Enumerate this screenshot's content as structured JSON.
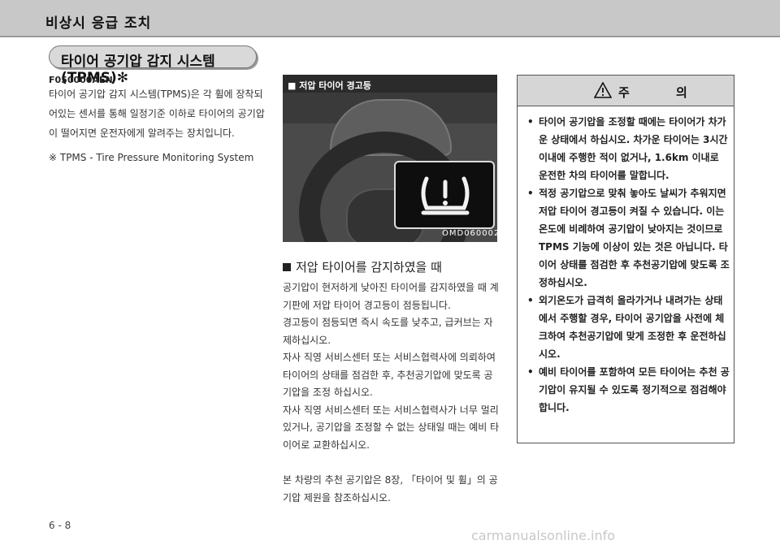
{
  "header": {
    "title": "비상시 응급 조치"
  },
  "section": {
    "title": "타이어 공기압 감지 시스템(TPMS)✻",
    "code": "F050000AEN",
    "intro": "타이어 공기압 감지 시스템(TPMS)은 각 휠에 장착되어있는 센서를 통해 일정기준 이하로 타이어의 공기압이 떨어지면 운전자에게 알려주는 장치입니다.",
    "note": "※ TPMS - Tire Pressure Monitoring System"
  },
  "photo": {
    "label": "■ 저압 타이어 경고등",
    "id": "OMD060002"
  },
  "low_pressure": {
    "heading": "저압 타이어를 감지하였을 때",
    "paragraphs": [
      "공기압이 현저하게 낮아진 타이어를 감지하였을 때 계기판에 저압 타이어 경고등이 점등됩니다.",
      "경고등이 점등되면 즉시 속도를 낮추고, 급커브는 자제하십시오.",
      "자사 직영 서비스센터 또는 서비스협력사에 의뢰하여 타이어의 상태를 점검한 후, 추천공기압에 맞도록 공기압을 조정 하십시오.",
      "자사 직영 서비스센터 또는 서비스협력사가 너무 멀리 있거나, 공기압을 조정할 수 없는 상태일 때는 예비 타이어로 교환하십시오."
    ],
    "reference": "본 차량의 추천 공기압은 8장, 「타이어 및 휠」의 공기압 제원을 참조하십시오."
  },
  "caution": {
    "title": "주 의",
    "items": [
      "타이어 공기압을 조정할 때에는 타이어가 차가운 상태에서 하십시오. 차가운 타이어는 3시간 이내에 주행한 적이 없거나, 1.6km 이내로 운전한 차의 타이어를 말합니다.",
      "적정 공기압으로 맞춰 놓아도 날씨가 추워지면 저압 타이어 경고등이 켜질 수 있습니다. 이는 온도에 비례하여 공기압이 낮아지는 것이므로 TPMS 기능에 이상이 있는 것은 아닙니다. 타이어 상태를 점검한 후 추천공기압에 맞도록 조정하십시오.",
      "외기온도가 급격히 올라가거나 내려가는 상태에서 주행할 경우, 타이어 공기압을 사전에 체크하여 추천공기압에 맞게 조정한 후 운전하십시오.",
      "예비 타이어를 포함하여 모든 타이어는 추천 공기압이 유지될 수 있도록 정기적으로 점검해야 합니다."
    ]
  },
  "footer": {
    "page": "6 - 8",
    "watermark": "carmanualsonline.info"
  }
}
